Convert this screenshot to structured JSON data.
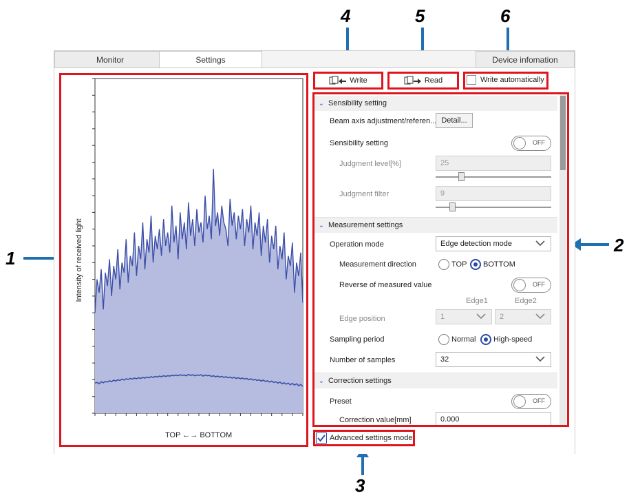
{
  "callouts": {
    "c1": "1",
    "c2": "2",
    "c3": "3",
    "c4": "4",
    "c5": "5",
    "c6": "6"
  },
  "tabs": {
    "monitor": "Monitor",
    "settings": "Settings",
    "device": "Device infomation"
  },
  "chart_data": {
    "type": "area",
    "ylabel": "Intensity of received light",
    "xlabel": "TOP ←→ BOTTOM",
    "fill_color": "#b5bce0",
    "line_color": "#3b4ea8",
    "series": [
      {
        "values": [
          0.3,
          0.4,
          0.36,
          0.43,
          0.31,
          0.42,
          0.38,
          0.46,
          0.35,
          0.44,
          0.4,
          0.49,
          0.37,
          0.45,
          0.42,
          0.52,
          0.39,
          0.47,
          0.44,
          0.54,
          0.41,
          0.5,
          0.46,
          0.57,
          0.43,
          0.52,
          0.48,
          0.59,
          0.45,
          0.53,
          0.49,
          0.55,
          0.47,
          0.58,
          0.5,
          0.54,
          0.48,
          0.62,
          0.51,
          0.56,
          0.46,
          0.6,
          0.52,
          0.57,
          0.49,
          0.63,
          0.53,
          0.58,
          0.5,
          0.61,
          0.54,
          0.57,
          0.51,
          0.65,
          0.55,
          0.59,
          0.52,
          0.73,
          0.56,
          0.6,
          0.53,
          0.62,
          0.57,
          0.55,
          0.5,
          0.64,
          0.56,
          0.6,
          0.52,
          0.59,
          0.55,
          0.61,
          0.5,
          0.58,
          0.54,
          0.62,
          0.49,
          0.57,
          0.53,
          0.6,
          0.47,
          0.56,
          0.51,
          0.58,
          0.45,
          0.53,
          0.49,
          0.56,
          0.43,
          0.5,
          0.46,
          0.54,
          0.4,
          0.47,
          0.44,
          0.51,
          0.36,
          0.45,
          0.41,
          0.48,
          0.33
        ]
      },
      {
        "values": [
          0.09,
          0.092,
          0.088,
          0.094,
          0.091,
          0.095,
          0.093,
          0.097,
          0.094,
          0.099,
          0.096,
          0.1,
          0.098,
          0.102,
          0.099,
          0.103,
          0.101,
          0.104,
          0.102,
          0.105,
          0.103,
          0.106,
          0.104,
          0.107,
          0.105,
          0.108,
          0.106,
          0.109,
          0.107,
          0.11,
          0.108,
          0.111,
          0.109,
          0.112,
          0.11,
          0.112,
          0.111,
          0.113,
          0.112,
          0.114,
          0.112,
          0.115,
          0.113,
          0.114,
          0.112,
          0.116,
          0.113,
          0.115,
          0.112,
          0.114,
          0.113,
          0.115,
          0.111,
          0.114,
          0.112,
          0.113,
          0.11,
          0.112,
          0.109,
          0.111,
          0.108,
          0.11,
          0.107,
          0.109,
          0.106,
          0.108,
          0.105,
          0.107,
          0.104,
          0.106,
          0.103,
          0.105,
          0.102,
          0.104,
          0.1,
          0.103,
          0.099,
          0.101,
          0.098,
          0.1,
          0.096,
          0.099,
          0.095,
          0.097,
          0.093,
          0.096,
          0.092,
          0.094,
          0.09,
          0.093,
          0.088,
          0.091,
          0.087,
          0.09,
          0.085,
          0.089,
          0.084,
          0.088,
          0.082,
          0.086,
          0.08
        ]
      }
    ]
  },
  "toolbar": {
    "write": "Write",
    "read": "Read",
    "write_auto": "Write automatically"
  },
  "sections": {
    "sensibility": {
      "title": "Sensibility setting",
      "beam_label": "Beam axis adjustment/referen...",
      "detail_btn": "Detail...",
      "sens_label": "Sensibility setting",
      "sens_toggle": "OFF",
      "judgment_level_label": "Judgment level[%]",
      "judgment_level_value": "25",
      "judgment_level_slider": 0.22,
      "judgment_filter_label": "Judgment filter",
      "judgment_filter_value": "9",
      "judgment_filter_slider": 0.14
    },
    "measurement": {
      "title": "Measurement settings",
      "op_mode_label": "Operation mode",
      "op_mode_value": "Edge detection mode",
      "meas_dir_label": "Measurement direction",
      "dir_top": "TOP",
      "dir_bottom": "BOTTOM",
      "reverse_label": "Reverse of measured value",
      "reverse_toggle": "OFF",
      "edge1": "Edge1",
      "edge2": "Edge2",
      "edge_pos_label": "Edge position",
      "edge1_value": "1",
      "edge2_value": "2",
      "sampling_label": "Sampling period",
      "sampling_normal": "Normal",
      "sampling_high": "High-speed",
      "samples_label": "Number of samples",
      "samples_value": "32"
    },
    "correction": {
      "title": "Correction settings",
      "preset_label": "Preset",
      "preset_toggle": "OFF",
      "corr_label": "Correction value[mm]",
      "corr_value": "0.000"
    }
  },
  "advanced": {
    "label": "Advanced settings mode",
    "checked": true
  },
  "colors": {
    "red_box": "#e0141c",
    "arrow": "#1f6fb2",
    "accent": "#2a4aa6"
  }
}
